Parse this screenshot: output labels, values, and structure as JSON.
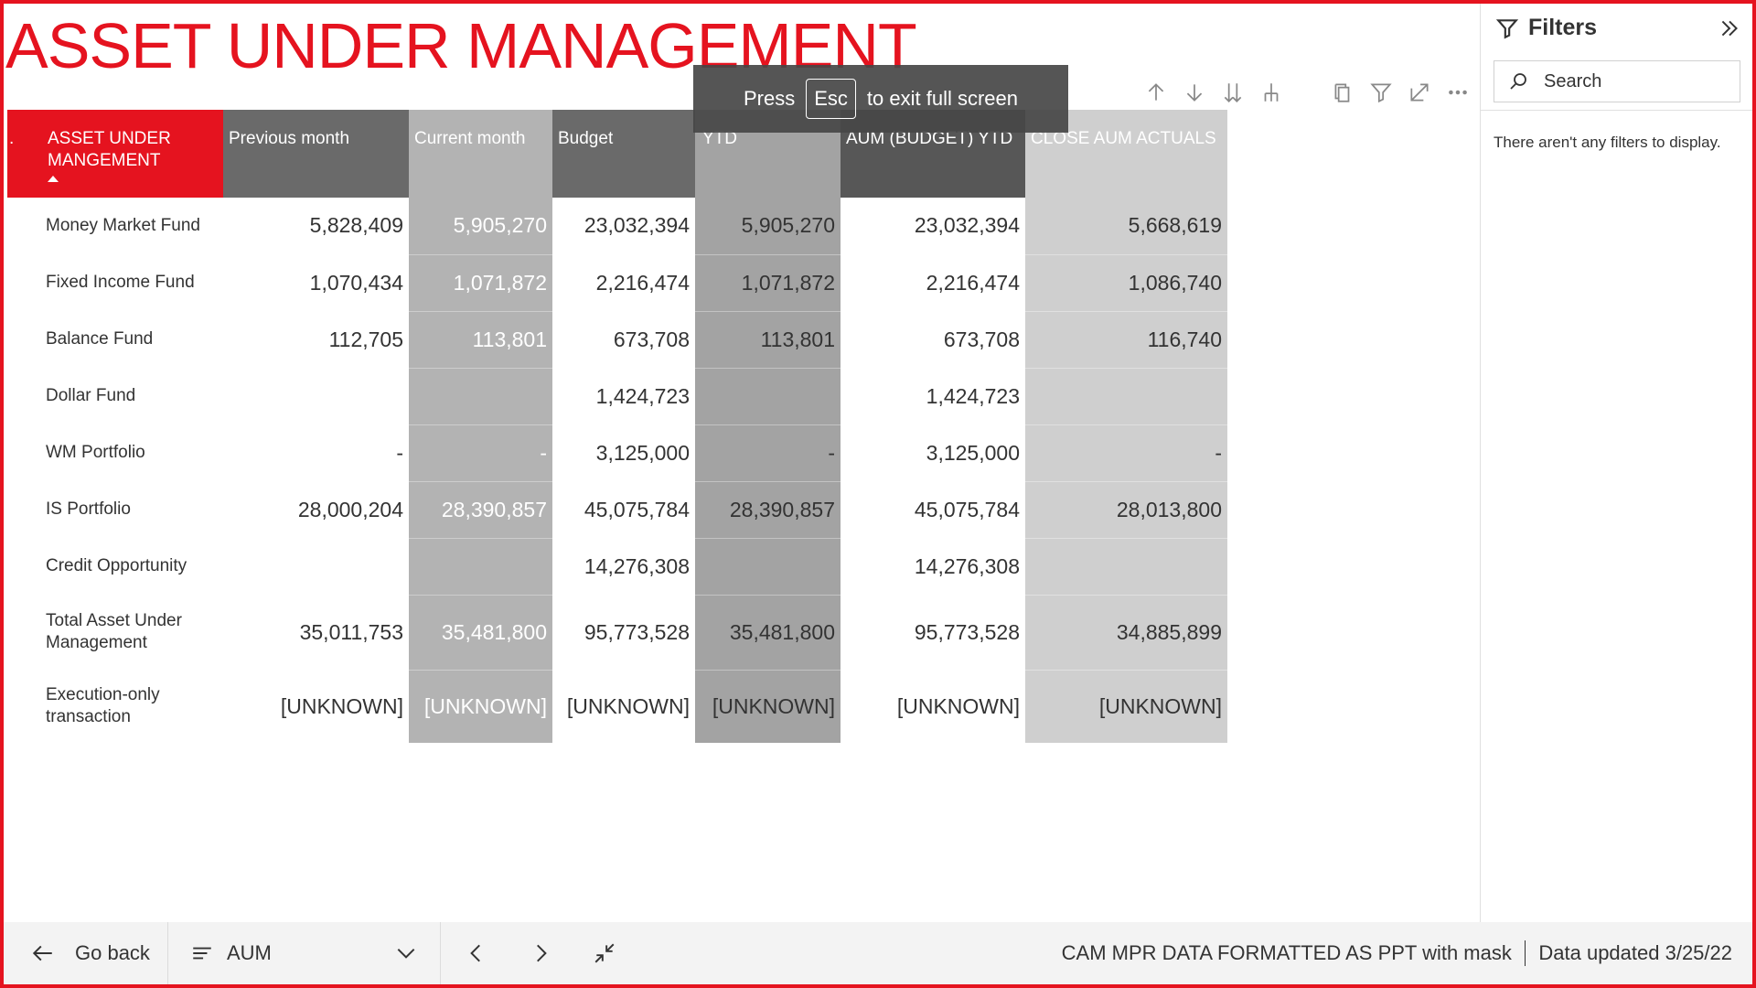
{
  "report": {
    "title": "ASSET UNDER MANAGEMENT"
  },
  "toast": {
    "press": "Press",
    "key": "Esc",
    "message": "to exit full screen"
  },
  "matrix": {
    "corner": ".",
    "columns": [
      "ASSET UNDER MANGEMENT",
      "Previous month",
      "Current month",
      "Budget",
      "YTD",
      "AUM (BUDGET) YTD",
      "CLOSE AUM ACTUALS"
    ],
    "rows": [
      {
        "label": "Money Market Fund",
        "values": [
          "5,828,409",
          "5,905,270",
          "23,032,394",
          "5,905,270",
          "23,032,394",
          "5,668,619"
        ]
      },
      {
        "label": "Fixed Income Fund",
        "values": [
          "1,070,434",
          "1,071,872",
          "2,216,474",
          "1,071,872",
          "2,216,474",
          "1,086,740"
        ]
      },
      {
        "label": "Balance Fund",
        "values": [
          "112,705",
          "113,801",
          "673,708",
          "113,801",
          "673,708",
          "116,740"
        ]
      },
      {
        "label": "Dollar Fund",
        "values": [
          "",
          "",
          "1,424,723",
          "",
          "1,424,723",
          ""
        ]
      },
      {
        "label": "WM Portfolio",
        "values": [
          "-",
          "-",
          "3,125,000",
          "-",
          "3,125,000",
          "-"
        ]
      },
      {
        "label": "IS Portfolio",
        "values": [
          "28,000,204",
          "28,390,857",
          "45,075,784",
          "28,390,857",
          "45,075,784",
          "28,013,800"
        ]
      },
      {
        "label": "Credit Opportunity",
        "values": [
          "",
          "",
          "14,276,308",
          "",
          "14,276,308",
          ""
        ]
      },
      {
        "label": "Total Asset Under Management",
        "values": [
          "35,011,753",
          "35,481,800",
          "95,773,528",
          "35,481,800",
          "95,773,528",
          "34,885,899"
        ]
      },
      {
        "label": "Execution-only transaction",
        "values": [
          "[UNKNOWN]",
          "[UNKNOWN]",
          "[UNKNOWN]",
          "[UNKNOWN]",
          "[UNKNOWN]",
          "[UNKNOWN]"
        ]
      }
    ]
  },
  "filters": {
    "title": "Filters",
    "search_placeholder": "Search",
    "empty_message": "There aren't any filters to display."
  },
  "bottom_bar": {
    "go_back": "Go back",
    "page_name": "AUM",
    "report_name": "CAM MPR DATA FORMATTED AS PPT with mask",
    "data_updated": "Data updated 3/25/22"
  },
  "colors": {
    "accent": "#e5131f",
    "header_dark": "#6a6a6a",
    "header_darker": "#575757",
    "band_current": "#b3b3b3",
    "band_ytd": "#a3a3a3",
    "band_close": "#cfcfcf"
  },
  "icons": {
    "visual_header": [
      "arrow-up-icon",
      "arrow-down-icon",
      "double-arrow-down-icon",
      "expand-hierarchy-icon",
      "copy-icon",
      "filter-icon",
      "focus-mode-icon",
      "more-options-icon"
    ]
  }
}
